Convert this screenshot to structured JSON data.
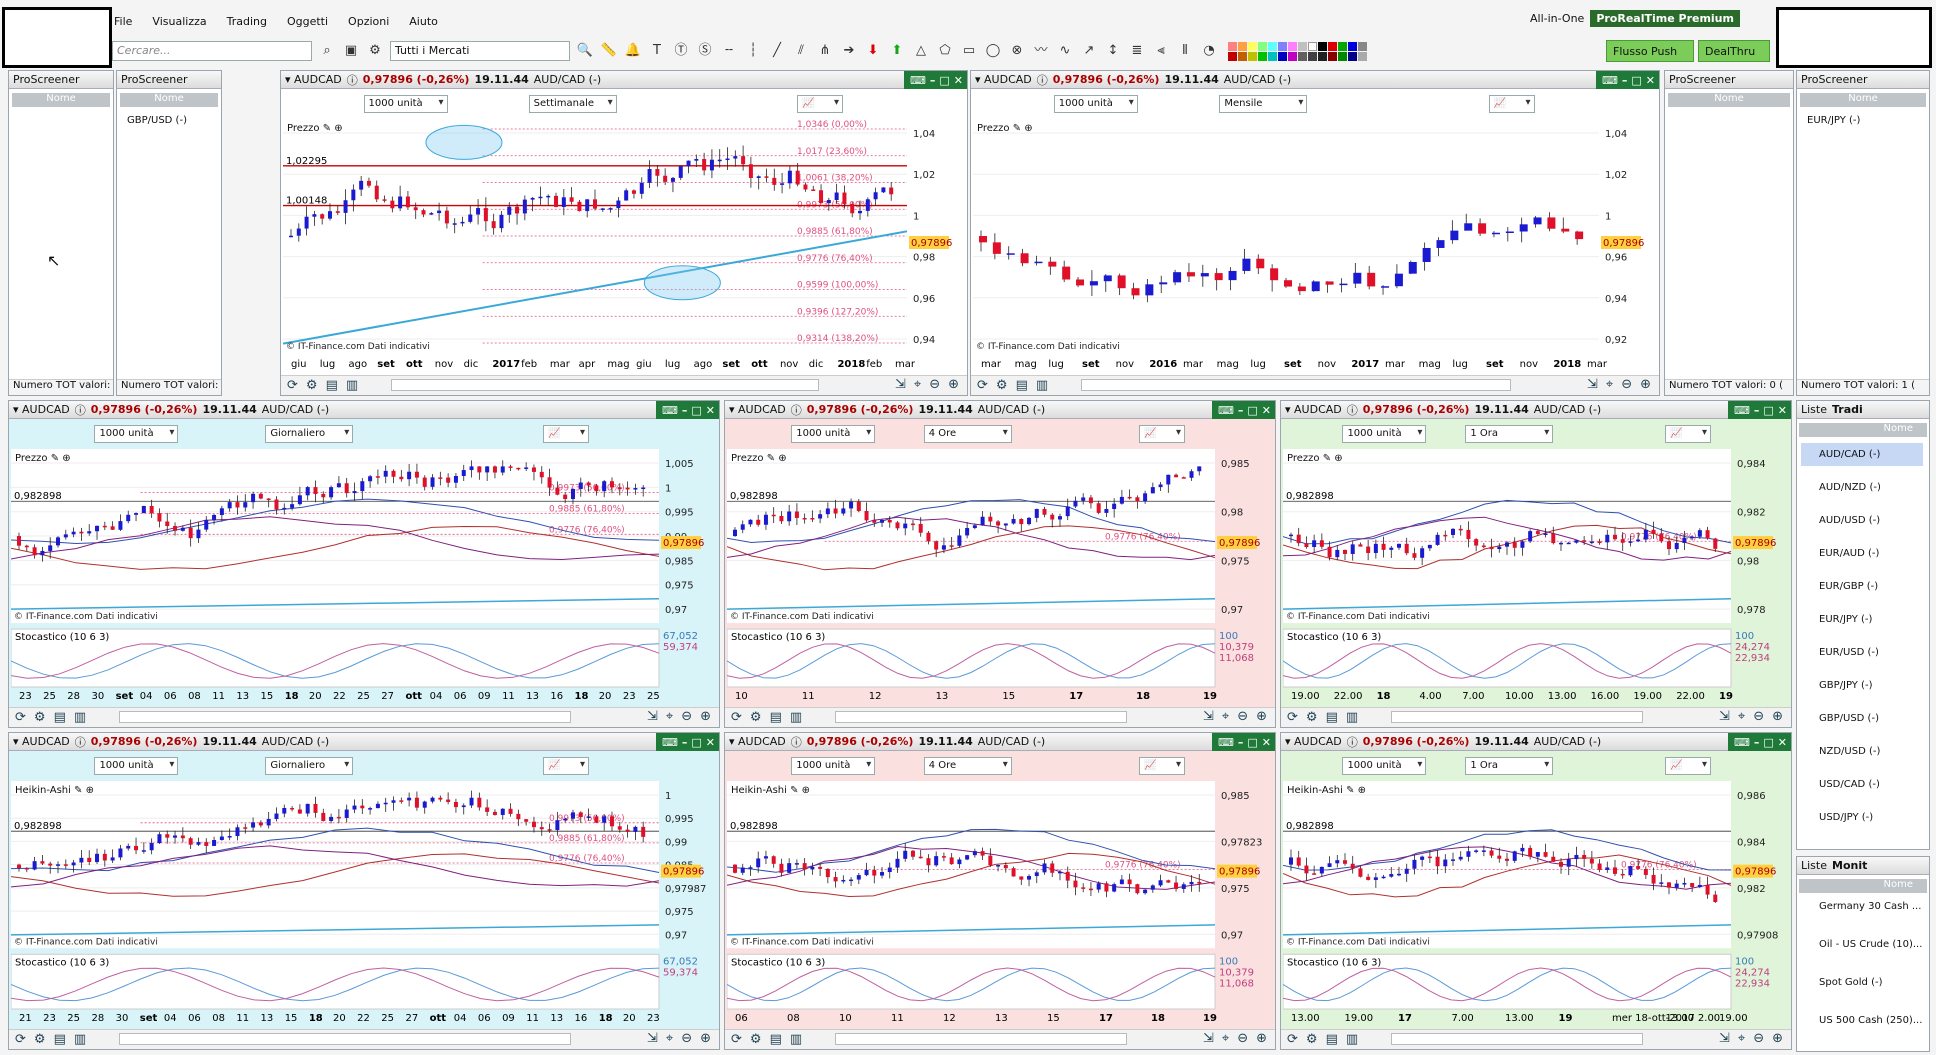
{
  "menu": [
    "File",
    "Visualizza",
    "Trading",
    "Oggetti",
    "Opzioni",
    "Aiuto"
  ],
  "toolbar": {
    "search_placeholder": "Cercare...",
    "market": "Tutti i Mercati"
  },
  "topright": {
    "mode": "All-in-One",
    "brand": "ProRealTime Premium",
    "push": "Flusso Push",
    "dealthru": "DealThru"
  },
  "screener": {
    "title": "ProScreener",
    "col": "Nome",
    "footer": "Numero TOT valori: 0 (",
    "footer1": "Numero TOT valori: 1 (",
    "footer_r": "Numero TOT valori: 0 (",
    "footer_r1": "Numero TOT valori: 1 (",
    "val1": "GBP/USD (-)",
    "val2": "EUR/JPY (-)"
  },
  "header": {
    "symbol": "AUDCAD",
    "price": "0,97896 (-0,26%)",
    "time": "19.11.44",
    "pair": "AUD/CAD (-)"
  },
  "charts": {
    "units": "1000 unità",
    "tf_w": "Settimanale",
    "tf_m": "Mensile",
    "tf_d": "Giornaliero",
    "tf_4": "4 Ore",
    "tf_1": "1 Ora",
    "prezzo": "Prezzo",
    "heikin": "Heikin-Ashi",
    "stoc": "Stocastico (10 6 3)",
    "source": "© IT-Finance.com",
    "indic": "Dati indicativi",
    "last": "0,97896",
    "level1": "1,02295",
    "level2": "1,00148",
    "level3": "0,982898",
    "fib_w": [
      "1,0346 (0,00%)",
      "1,017 (23,60%)",
      "1,0061 (38,20%)",
      "0,9973 (50,00%)",
      "0,9885 (61,80%)",
      "0,9776 (76,40%)",
      "0,9599 (100,00%)",
      "0,9396 (127,20%)",
      "0,9314 (138,20%)"
    ],
    "fib_d": [
      "0,9973 (50,00%)",
      "0,9885 (61,80%)",
      "0,9776 (76,40%)"
    ],
    "fib_s": "0,9776 (76,40%)",
    "axis_w": [
      "1,04",
      "1,02",
      "1",
      "0,98",
      "0,96",
      "0,94"
    ],
    "axis_m": [
      "1,04",
      "1,02",
      "1",
      "0,96",
      "0,94",
      "0,92"
    ],
    "axis_d": [
      "1,005",
      "1",
      "0,995",
      "0,99",
      "0,985",
      "0,975",
      "0,97"
    ],
    "axis_4": [
      "0,985",
      "0,98",
      "0,975",
      "0,97"
    ],
    "axis_1": [
      "0,984",
      "0,982",
      "0,98",
      "0,978"
    ],
    "axis_dh": [
      "1",
      "0,995",
      "0,99",
      "0,985",
      "0,97987",
      "0,975",
      "0,97"
    ],
    "axis_4h": [
      "0,985",
      "0,97823",
      "0,975",
      "0,97"
    ],
    "axis_1h": [
      "0,986",
      "0,984",
      "0,982",
      "0,97908"
    ],
    "stoc_d": [
      "67,052",
      "59,374"
    ],
    "stoc_4": [
      "100",
      "10,379",
      "11,068"
    ],
    "stoc_1": [
      "100",
      "24,274",
      "22,934"
    ],
    "x_w": [
      "giu",
      "lug",
      "ago",
      "set",
      "ott",
      "nov",
      "dic",
      "2017",
      "feb",
      "mar",
      "apr",
      "mag",
      "giu",
      "lug",
      "ago",
      "set",
      "ott",
      "nov",
      "dic",
      "2018",
      "feb",
      "mar"
    ],
    "x_m": [
      "mar",
      "mag",
      "lug",
      "set",
      "nov",
      "2016",
      "mar",
      "mag",
      "lug",
      "set",
      "nov",
      "2017",
      "mar",
      "mag",
      "lug",
      "set",
      "nov",
      "2018",
      "mar"
    ],
    "x_d": [
      "23",
      "25",
      "28",
      "30",
      "set",
      "04",
      "06",
      "08",
      "11",
      "13",
      "15",
      "18",
      "20",
      "22",
      "25",
      "27",
      "ott",
      "04",
      "06",
      "09",
      "11",
      "13",
      "16",
      "18",
      "20",
      "23",
      "25"
    ],
    "x_4": [
      "10",
      "11",
      "12",
      "13",
      "15",
      "17",
      "18",
      "19"
    ],
    "x_1": [
      "19.00",
      "22.00",
      "18",
      "4.00",
      "7.00",
      "10.00",
      "13.00",
      "16.00",
      "19.00",
      "22.00",
      "19"
    ],
    "x_dh": [
      "21",
      "23",
      "25",
      "28",
      "30",
      "set",
      "04",
      "06",
      "08",
      "11",
      "13",
      "15",
      "18",
      "20",
      "22",
      "25",
      "27",
      "ott",
      "04",
      "06",
      "09",
      "11",
      "13",
      "16",
      "18",
      "20",
      "23"
    ],
    "x_4h": [
      "06",
      "08",
      "10",
      "11",
      "12",
      "13",
      "15",
      "17",
      "18",
      "19"
    ],
    "x_1h": [
      "13.00",
      "19.00",
      "17",
      "7.00",
      "13.00",
      "19",
      "mer 18-ott-2017 2.00",
      "13.00",
      "19.00"
    ]
  },
  "lists": {
    "tab1": "Liste",
    "tab2": "Tradi",
    "tab3": "Liste",
    "tab4": "Monit",
    "col": "Nome",
    "fx": [
      "AUD/CAD (-)",
      "AUD/NZD (-)",
      "AUD/USD (-)",
      "EUR/AUD (-)",
      "EUR/GBP (-)",
      "EUR/JPY (-)",
      "EUR/USD (-)",
      "GBP/JPY (-)",
      "GBP/USD (-)",
      "NZD/USD (-)",
      "USD/CAD (-)",
      "USD/JPY (-)"
    ],
    "mon": [
      "Germany 30 Cash ...",
      "Oil - US Crude (10)...",
      "Spot Gold (-)",
      "US 500 Cash (250)..."
    ]
  },
  "colors": {
    "bull": "#1a1ad0",
    "bear": "#e0102a",
    "fib": "#e05080",
    "trend": "#3aa8d8",
    "green_bg": "#dff4d8",
    "cyan_bg": "#d8f4f8",
    "pink_bg": "#fbe0e0"
  }
}
